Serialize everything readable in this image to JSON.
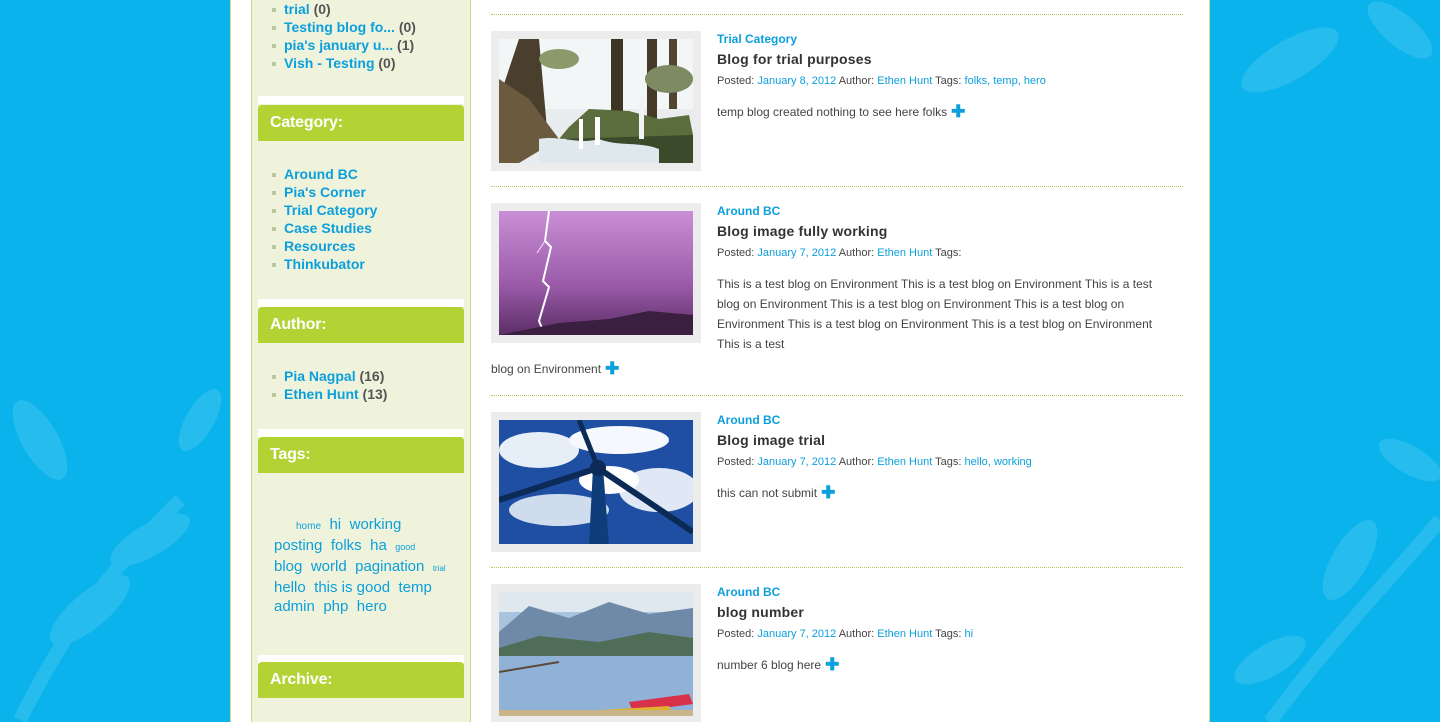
{
  "colors": {
    "background": "#0ab3ec",
    "accent_green": "#b3d335",
    "link_blue": "#0b9fdc",
    "sidebar_bg": "#f0f3dc"
  },
  "sidebar": {
    "recent_posts": [
      {
        "label": "trial",
        "count": "(0)"
      },
      {
        "label": "Testing blog fo...",
        "count": "(0)"
      },
      {
        "label": "pia's january u...",
        "count": "(1)"
      },
      {
        "label": "Vish - Testing",
        "count": "(0)"
      }
    ],
    "category": {
      "heading": "Category:",
      "items": [
        "Around BC",
        "Pia's Corner",
        "Trial Category",
        "Case Studies",
        "Resources",
        "Thinkubator"
      ]
    },
    "author": {
      "heading": "Author:",
      "items": [
        {
          "label": "Pia Nagpal",
          "count": "(16)"
        },
        {
          "label": "Ethen Hunt",
          "count": "(13)"
        }
      ]
    },
    "tags": {
      "heading": "Tags:",
      "items": [
        "home",
        "hi",
        "working",
        "posting",
        "folks",
        "ha",
        "good",
        "blog",
        "world",
        "pagination",
        "trial",
        "hello",
        "this is good",
        "temp",
        "admin",
        "php",
        "hero"
      ]
    },
    "archive": {
      "heading": "Archive:"
    }
  },
  "posts": [
    {
      "category": "Trial Category",
      "title": "Blog for trial purposes",
      "posted_label": "Posted:",
      "date": "January 8, 2012",
      "author_label": "Author:",
      "author": "Ethen Hunt",
      "tags_label": "Tags:",
      "tags": "folks, temp, hero",
      "excerpt": "temp blog created nothing to see here folks",
      "image": "forest-waterfall-photo"
    },
    {
      "category": "Around BC",
      "title": "Blog image fully working",
      "posted_label": "Posted:",
      "date": "January 7, 2012",
      "author_label": "Author:",
      "author": "Ethen Hunt",
      "tags_label": "Tags:",
      "tags": "",
      "excerpt": "This is a test blog on Environment This is a test blog on Environment This is a test blog on Environment This is a test blog on Environment This is a test blog on Environment This is a test blog on Environment This is a test blog on Environment This is a test",
      "excerpt_tail": "blog on Environment",
      "image": "lightning-photo"
    },
    {
      "category": "Around BC",
      "title": "Blog image trial",
      "posted_label": "Posted:",
      "date": "January 7, 2012",
      "author_label": "Author:",
      "author": "Ethen Hunt",
      "tags_label": "Tags:",
      "tags": "hello, working",
      "excerpt": "this can not submit",
      "image": "wind-turbine-photo"
    },
    {
      "category": "Around BC",
      "title": "blog number",
      "posted_label": "Posted:",
      "date": "January 7, 2012",
      "author_label": "Author:",
      "author": "Ethen Hunt",
      "tags_label": "Tags:",
      "tags": "hi",
      "excerpt": "number 6 blog here",
      "image": "lake-kayak-photo"
    }
  ],
  "more_icon": "plus-icon",
  "more_glyph": "✚"
}
